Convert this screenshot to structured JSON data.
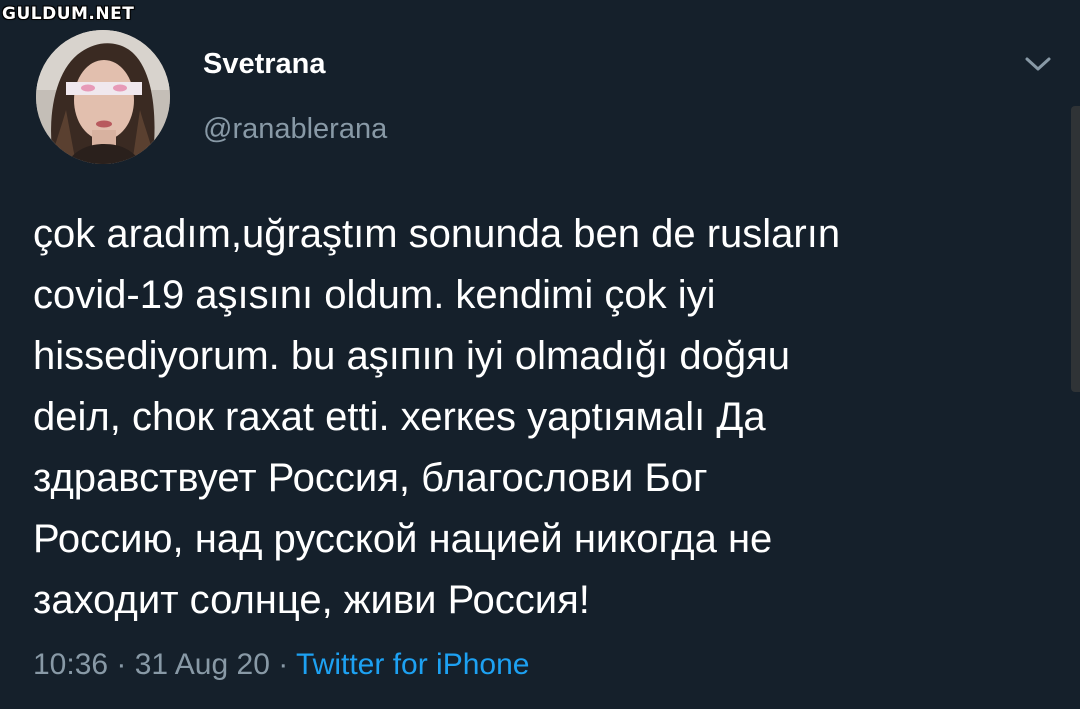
{
  "watermark": "GULDUM.NET",
  "user": {
    "display_name": "Svetrana",
    "handle": "@ranablerana"
  },
  "tweet": {
    "lines": [
      "çok aradım,uğraştım sonunda ben de rusların",
      "covid-19 aşısını oldum. kendimi çok iyi",
      "hissediyorum. bu aşıпın iyi olmadığı doğяu",
      "deiл, chок raxat etti. хеrкеs yaptıямalı Да",
      "здравствует Россия, благослови Бог",
      "Россию, над русской нацией никогда не",
      "заходит солнце, живи Россия!"
    ]
  },
  "meta": {
    "time": "10:36",
    "separator1": " · ",
    "date": "31 Aug 20",
    "separator2": " · ",
    "source": "Twitter for iPhone"
  },
  "icons": {
    "menu": "chevron-down-icon"
  },
  "colors": {
    "background": "#15202b",
    "primary_text": "#ffffff",
    "secondary_text": "#8899a6",
    "link": "#1da1f2"
  }
}
